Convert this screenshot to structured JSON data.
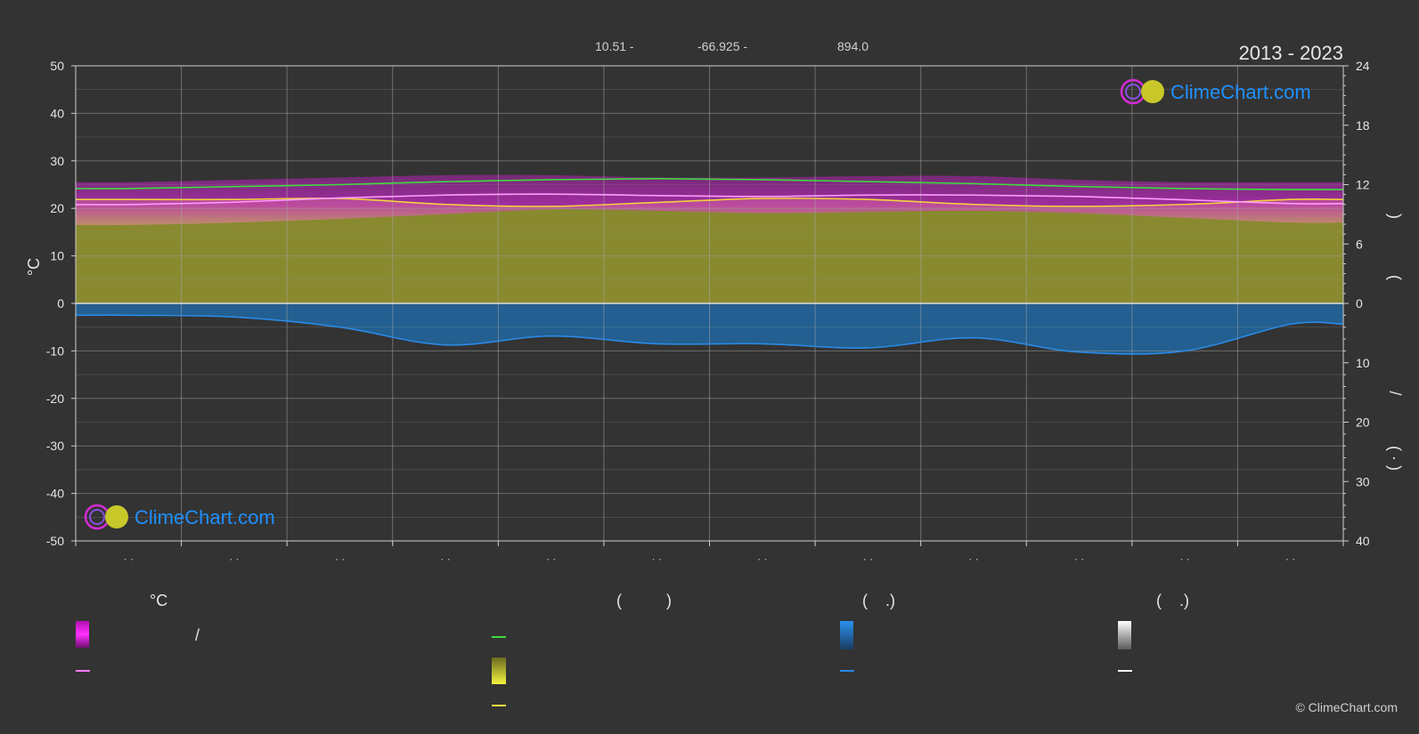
{
  "header": {
    "latitude": "10.51 -",
    "longitude": "-66.925 -",
    "elevation": "894.0",
    "period": "2013 - 2023"
  },
  "logo_text": "ClimeChart.com",
  "copyright": "© ClimeChart.com",
  "legend": {
    "col1_heading": "°C",
    "col1_slash": "/",
    "col2_heading": "(          )",
    "col3_heading": "(    .)",
    "col4_heading": "(    .)"
  },
  "axis_extra": {
    "right_paren_open": "(",
    "right_paren_close": ")",
    "right_slash": "/",
    "right_bottom_paren": "(  ·  )"
  },
  "colors": {
    "background": "#333333",
    "temp_band": "#d42bd4",
    "temp_band_lower": "#e0a0a0",
    "daylight_line": "#3ddc3d",
    "sunshine_fill": "#a8a832",
    "sunshine_line": "#f0d23c",
    "avg_temp_line": "#ff9bff",
    "precip_fill": "#1f6fb0",
    "precip_line": "#2a8ae6",
    "logo_blue": "#1e90ff"
  },
  "chart_data": {
    "type": "area",
    "months": [
      "· ·",
      "· ·",
      "· ·",
      "· ·",
      "· ·",
      "· ·",
      "· ·",
      "· ·",
      "· ·",
      "· ·",
      "· ·",
      "· ·"
    ],
    "left_axis": {
      "label": "°C",
      "ylim": [
        -50,
        50
      ],
      "ticks": [
        50,
        40,
        30,
        20,
        10,
        0,
        -10,
        -20,
        -30,
        -40,
        -50
      ]
    },
    "right_axis_top": {
      "ylim": [
        0,
        24
      ],
      "ticks": [
        24,
        18,
        12,
        6,
        0
      ]
    },
    "right_axis_bottom": {
      "ylim": [
        0,
        40
      ],
      "ticks": [
        10,
        20,
        30,
        40
      ]
    },
    "grid": true,
    "series": [
      {
        "key": "daylight",
        "values": [
          11.6,
          11.8,
          12.0,
          12.3,
          12.5,
          12.6,
          12.5,
          12.3,
          12.1,
          11.8,
          11.6,
          11.5
        ]
      },
      {
        "key": "sunshine",
        "values": [
          10.5,
          10.5,
          10.6,
          10.0,
          9.8,
          10.2,
          10.6,
          10.5,
          10.0,
          9.8,
          10.0,
          10.5
        ]
      },
      {
        "key": "temp_max",
        "values": [
          25.5,
          26.0,
          26.5,
          27.0,
          27.0,
          26.5,
          26.5,
          26.8,
          26.8,
          26.0,
          25.5,
          25.5
        ]
      },
      {
        "key": "temp_mean",
        "values": [
          20.8,
          21.3,
          22.2,
          22.8,
          23.0,
          22.7,
          22.5,
          22.8,
          22.8,
          22.5,
          21.8,
          21.0
        ]
      },
      {
        "key": "temp_min",
        "values": [
          16.5,
          17.0,
          17.8,
          18.8,
          19.8,
          19.5,
          19.0,
          19.3,
          19.5,
          19.0,
          18.0,
          17.0
        ]
      },
      {
        "key": "precipitation",
        "values": [
          2.0,
          2.3,
          4.0,
          7.0,
          5.5,
          6.8,
          6.8,
          7.5,
          5.8,
          8.2,
          8.0,
          3.5
        ]
      }
    ]
  }
}
